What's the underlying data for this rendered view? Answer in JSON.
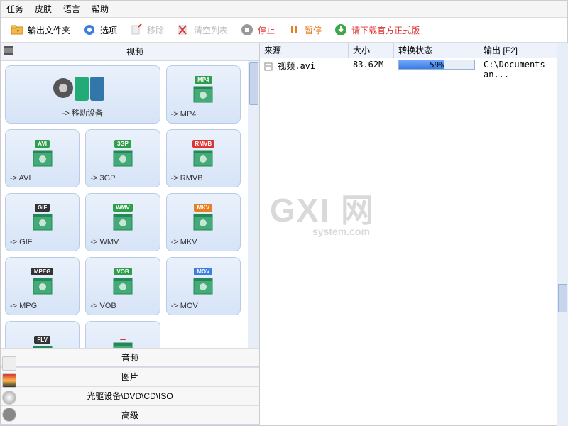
{
  "menu": {
    "items": [
      "任务",
      "皮肤",
      "语言",
      "帮助"
    ]
  },
  "toolbar": {
    "output_folder": "输出文件夹",
    "options": "选项",
    "remove": "移除",
    "clear_list": "清空列表",
    "stop": "停止",
    "pause": "暂停",
    "download": "请下载官方正式版"
  },
  "categories": {
    "video": "视频",
    "audio": "音频",
    "image": "图片",
    "disc": "光驱设备\\DVD\\CD\\ISO",
    "advanced": "高级"
  },
  "formats": [
    {
      "label": "-> 移动设备",
      "badge": "",
      "color": "#888",
      "large": true
    },
    {
      "label": "-> MP4",
      "badge": "MP4",
      "color": "#2e9e4a"
    },
    {
      "label": "-> AVI",
      "badge": "AVI",
      "color": "#2e9e4a"
    },
    {
      "label": "-> 3GP",
      "badge": "3GP",
      "color": "#2e9e4a"
    },
    {
      "label": "-> RMVB",
      "badge": "RMVB",
      "color": "#d33"
    },
    {
      "label": "-> GIF",
      "badge": "GIF",
      "color": "#333"
    },
    {
      "label": "-> WMV",
      "badge": "WMV",
      "color": "#2e9e4a"
    },
    {
      "label": "-> MKV",
      "badge": "MKV",
      "color": "#e67e22"
    },
    {
      "label": "-> MPG",
      "badge": "MPEG",
      "color": "#333"
    },
    {
      "label": "-> VOB",
      "badge": "VOB",
      "color": "#2e9e4a"
    },
    {
      "label": "-> MOV",
      "badge": "MOV",
      "color": "#3b7de0"
    },
    {
      "label": "",
      "badge": "FLV",
      "color": "#333"
    },
    {
      "label": "",
      "badge": "",
      "color": "#d33"
    }
  ],
  "table": {
    "headers": {
      "source": "来源",
      "size": "大小",
      "status": "转换状态",
      "output": "输出 [F2]"
    },
    "rows": [
      {
        "source": "视频.avi",
        "size": "83.62M",
        "progress_pct": 59,
        "progress_text": "59%",
        "output": "C:\\Documents an..."
      }
    ]
  },
  "watermark": {
    "main": "GXI 网",
    "sub": "system.com"
  }
}
